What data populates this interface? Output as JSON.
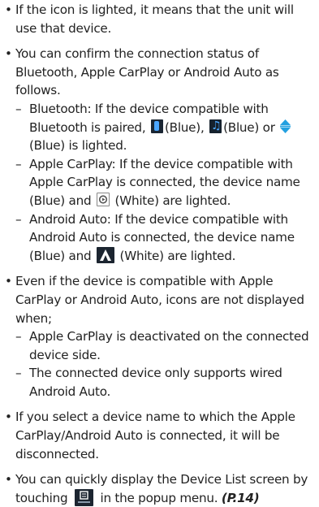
{
  "bullets": [
    {
      "text": "If the icon is lighted, it means that the unit will use that device."
    },
    {
      "text": "You can confirm the connection status of Bluetooth, Apple CarPlay or Android Auto as follows.",
      "subs": {
        "bluetooth": {
          "pre": "Bluetooth: If the device compatible with Bluetooth is paired,",
          "blue1": "(Blue),",
          "blue2": "(Blue) or",
          "blue3": "(Blue) is lighted."
        },
        "carplay": {
          "pre": "Apple CarPlay: If the device compatible with Apple CarPlay is connected, the device name (Blue) and",
          "post": "(White) are lighted."
        },
        "android": {
          "pre": "Android Auto: If the device compatible with Android Auto is connected, the device name (Blue) and",
          "post": "(White) are lighted."
        }
      }
    },
    {
      "text": "Even if the device is compatible with Apple CarPlay or Android Auto, icons are not displayed when;",
      "subs": [
        "Apple CarPlay is deactivated on the connected device side.",
        "The connected device only supports wired Android Auto."
      ]
    },
    {
      "text": "If you select a device name to which the Apple CarPlay/Android Auto is connected, it will be disconnected."
    },
    {
      "pre": "You can quickly display the Device List screen by touching",
      "post": "in the popup menu.",
      "ref": "(P.14)"
    }
  ],
  "glyphs": {
    "bullet": "•",
    "dash": "–"
  },
  "icons": {
    "bt_phone": "phone-blue-icon",
    "bt_audio": "audio-blue-icon",
    "bt_updown": "updown-arrows-blue-icon",
    "carplay": "carplay-white-icon",
    "android_auto": "android-auto-white-icon",
    "device_list": "device-list-icon"
  },
  "colors": {
    "blue": "#4aa6ff",
    "text": "#222222"
  }
}
